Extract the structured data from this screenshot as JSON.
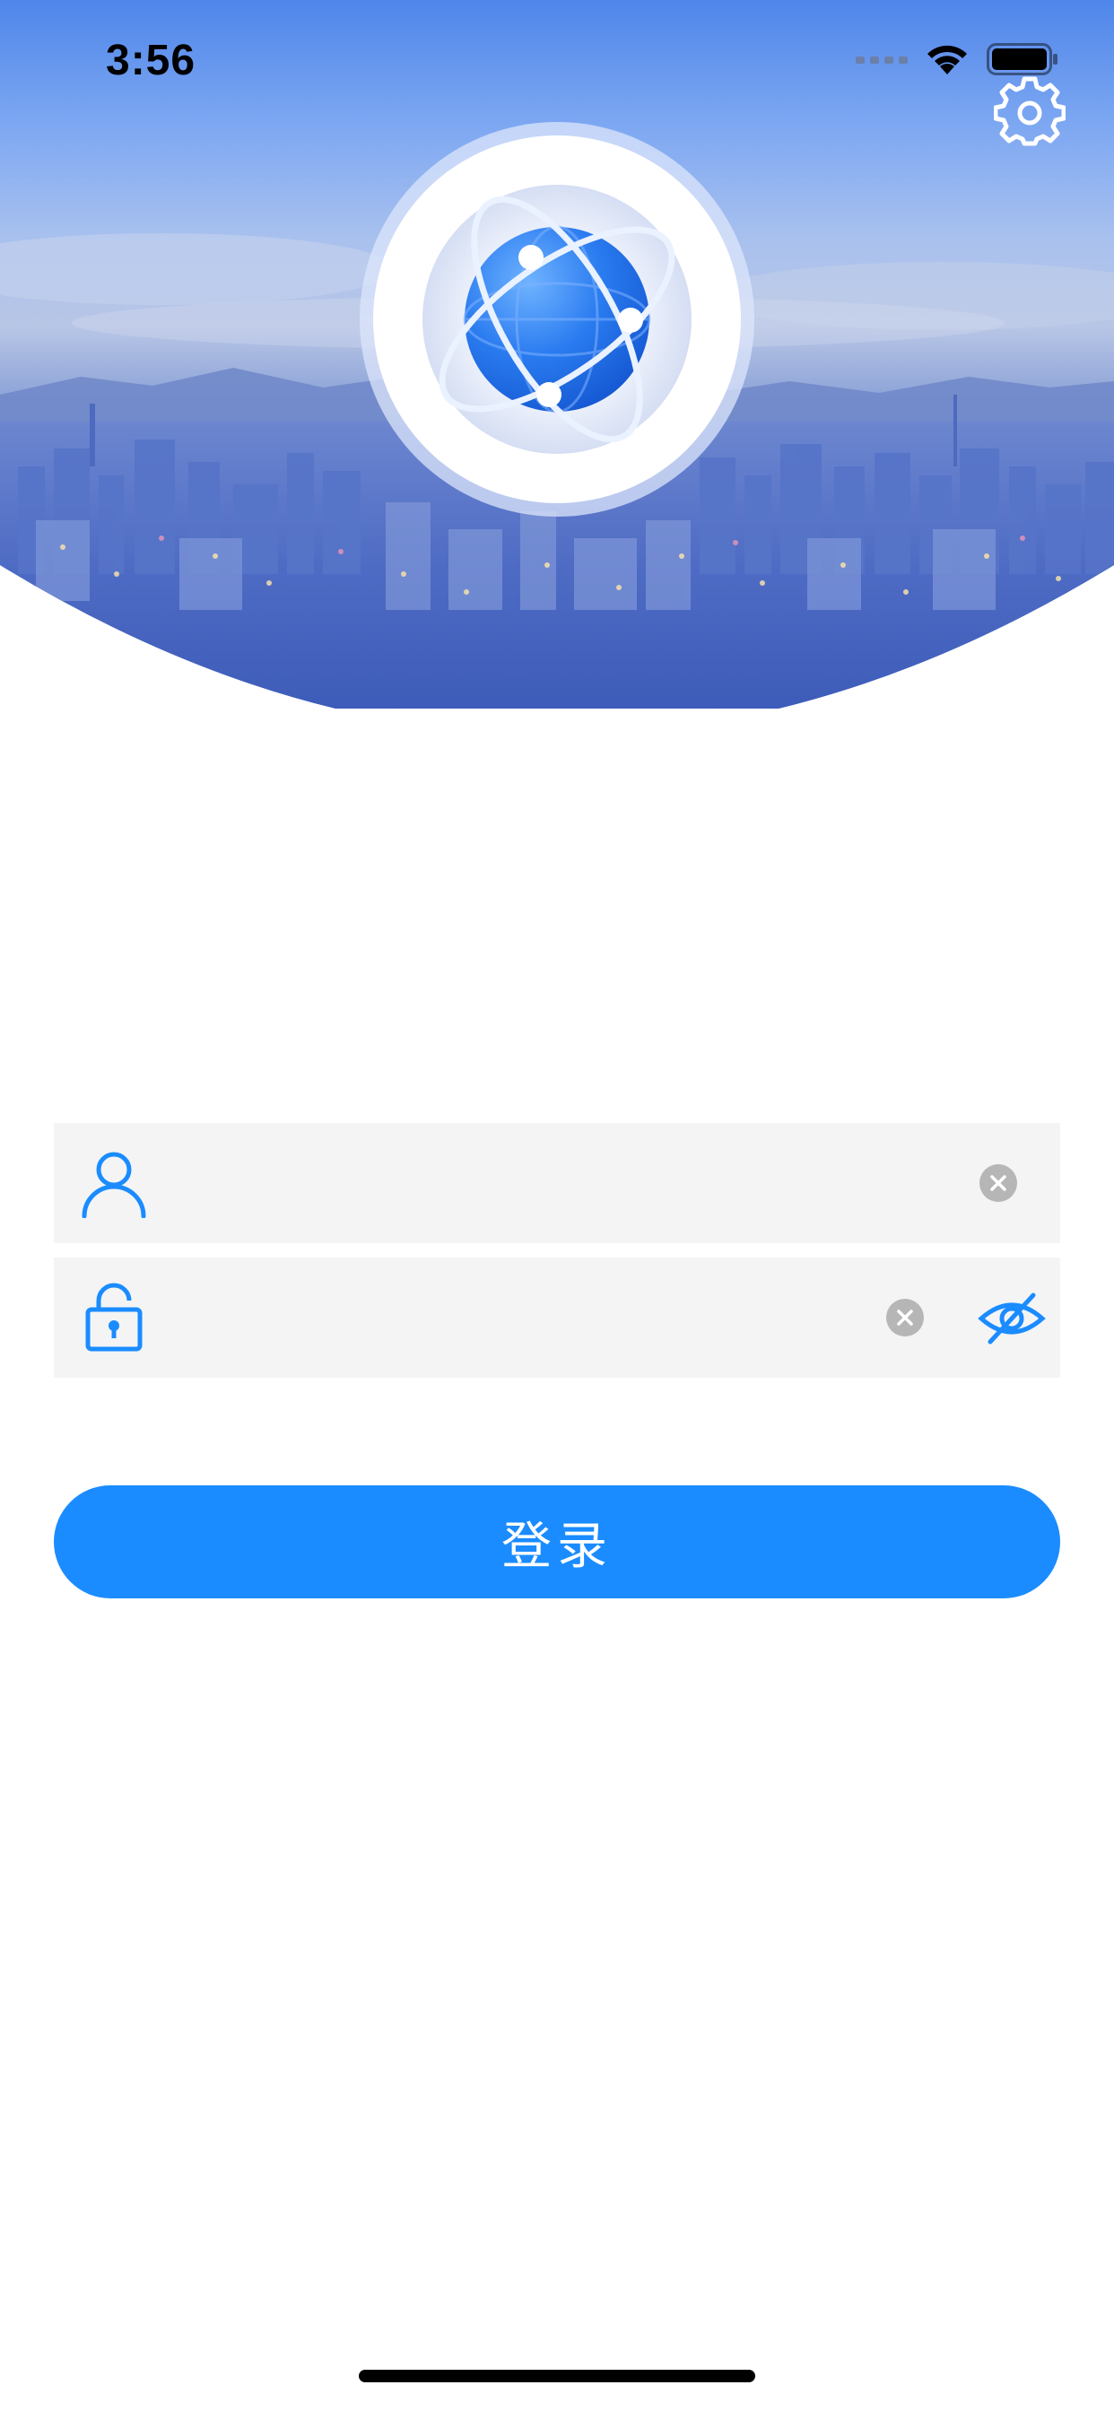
{
  "status_bar": {
    "time": "3:56"
  },
  "icons": {
    "settings": "gear-icon",
    "logo": "globe-orbit-logo",
    "username": "user-icon",
    "password": "lock-icon",
    "clear": "clear-circle-x-icon",
    "visibility": "eye-slash-icon"
  },
  "form": {
    "username": {
      "value": "",
      "placeholder": ""
    },
    "password": {
      "value": "",
      "placeholder": ""
    },
    "login_button_label": "登录"
  },
  "colors": {
    "accent": "#1a8cff",
    "field_background": "#f4f4f4",
    "clear_button": "#b6b6b6",
    "icon_blue": "#1a8cff"
  }
}
